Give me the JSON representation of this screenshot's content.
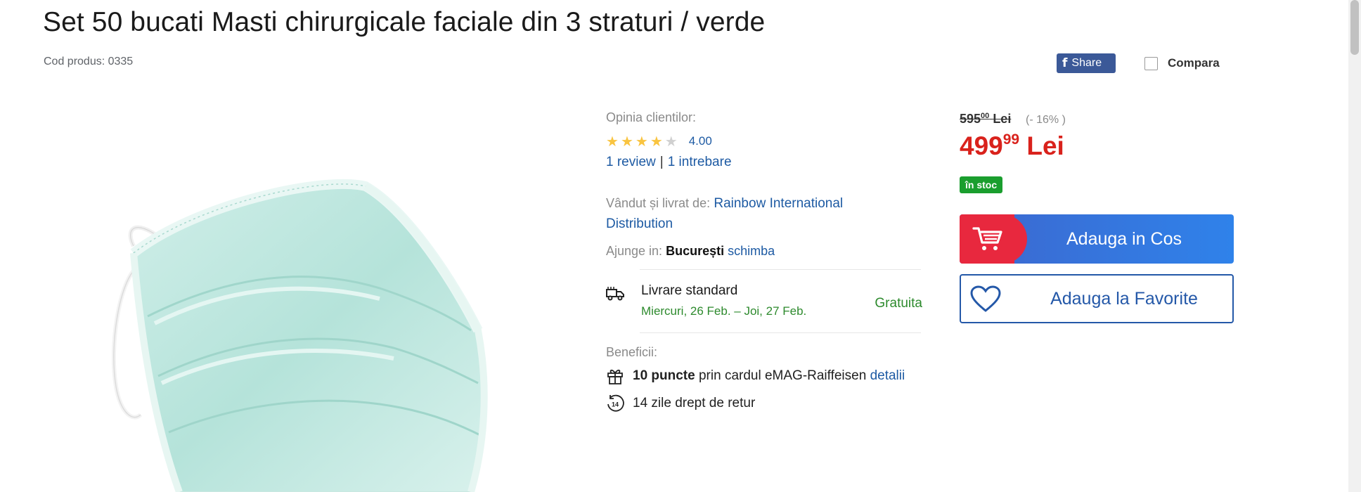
{
  "product": {
    "title": "Set 50 bucati Masti chirurgicale faciale din 3 straturi / verde",
    "code_label": "Cod produs: 0335"
  },
  "social": {
    "share_label": "Share",
    "compare_label": "Compara"
  },
  "reviews": {
    "label": "Opinia clientilor:",
    "rating": 4,
    "rating_max": 5,
    "rating_value": "4.00",
    "review_link": "1 review",
    "separator": "|",
    "question_link": "1 intrebare"
  },
  "seller": {
    "label": "Vândut și livrat de:",
    "name": "Rainbow International Distribution"
  },
  "arrival": {
    "label": "Ajunge in:",
    "city": "București",
    "change_link": "schimba"
  },
  "delivery": {
    "title": "Livrare standard",
    "dates": "Miercuri, 26 Feb. – Joi, 27 Feb.",
    "cost": "Gratuita"
  },
  "benefits": {
    "label": "Beneficii:",
    "points_bold": "10 puncte",
    "points_text": "prin cardul eMAG-Raiffeisen",
    "points_link": "detalii",
    "return_badge": "14",
    "return_text": "14 zile drept de retur"
  },
  "price": {
    "old_int": "595",
    "old_dec": "00",
    "old_currency": "Lei",
    "discount": "(- 16% )",
    "new_int": "499",
    "new_dec": "99",
    "new_currency": "Lei",
    "stock": "în stoc"
  },
  "actions": {
    "add_to_cart": "Adauga in Cos",
    "add_to_favorites": "Adauga la Favorite"
  },
  "colors": {
    "brand_blue": "#2458a8",
    "price_red": "#d9221c",
    "stock_green": "#1a9e2e",
    "facebook": "#3b5998"
  },
  "icons": [
    "facebook-icon",
    "star-icon",
    "truck-icon",
    "gift-icon",
    "return-14-icon",
    "cart-icon",
    "heart-icon"
  ]
}
